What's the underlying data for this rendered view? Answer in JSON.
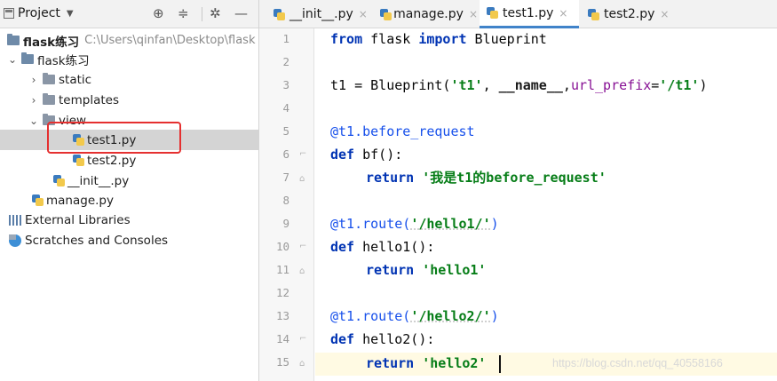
{
  "project_panel": {
    "title": "Project",
    "buttons": [
      "target-icon",
      "collapse-icon",
      "gear-icon",
      "hide-icon"
    ],
    "tree": [
      {
        "label": "flask练习",
        "path": "C:\\Users\\qinfan\\Desktop\\flask",
        "type": "root"
      },
      {
        "label": "flask练习",
        "type": "folder",
        "expanded": true
      },
      {
        "label": "static",
        "type": "folder",
        "expanded": false
      },
      {
        "label": "templates",
        "type": "folder",
        "expanded": false
      },
      {
        "label": "view",
        "type": "folder",
        "expanded": true
      },
      {
        "label": "test1.py",
        "type": "py",
        "selected": true
      },
      {
        "label": "test2.py",
        "type": "py"
      },
      {
        "label": "__init__.py",
        "type": "py"
      },
      {
        "label": "manage.py",
        "type": "py"
      },
      {
        "label": "External Libraries",
        "type": "libraries"
      },
      {
        "label": "Scratches and Consoles",
        "type": "scratches"
      }
    ]
  },
  "tabs": [
    {
      "label": "__init__.py",
      "active": false
    },
    {
      "label": "manage.py",
      "active": false
    },
    {
      "label": "test1.py",
      "active": true
    },
    {
      "label": "test2.py",
      "active": false
    }
  ],
  "editor": {
    "line_numbers": [
      "1",
      "2",
      "3",
      "4",
      "5",
      "6",
      "7",
      "8",
      "9",
      "10",
      "11",
      "12",
      "13",
      "14",
      "15"
    ],
    "tokens": {
      "l1_from": "from",
      "l1_mod": " flask ",
      "l1_import": "import",
      "l1_name": " Blueprint",
      "l3_a": "t1 = Blueprint(",
      "l3_s1": "'t1'",
      "l3_b": ", ",
      "l3_name": "__name__",
      "l3_c": ",",
      "l3_param": "url_prefix",
      "l3_d": "=",
      "l3_s2": "'/t1'",
      "l3_e": ")",
      "l5_deco": "@t1.before_request",
      "l6_def": "def",
      "l6_rest": " bf():",
      "l7_ret": "return",
      "l7_str": "'我是t1的before_request'",
      "l9_deco": "@t1.route(",
      "l9_str": "'/hello1/'",
      "l9_close": ")",
      "l10_def": "def",
      "l10_rest": " hello1():",
      "l11_ret": "return",
      "l11_str": "'hello1'",
      "l13_deco": "@t1.route(",
      "l13_str": "'/hello2/'",
      "l13_close": ")",
      "l14_def": "def",
      "l14_rest": " hello2():",
      "l15_ret": "return",
      "l15_str": "'hello2'"
    }
  },
  "watermark": "https://blog.csdn.net/qq_40558166",
  "colors": {
    "keyword": "#0033b3",
    "string": "#067d17",
    "decorator": "#1750eb",
    "highlight_box": "#e53030",
    "active_tab_underline": "#4083c9"
  }
}
